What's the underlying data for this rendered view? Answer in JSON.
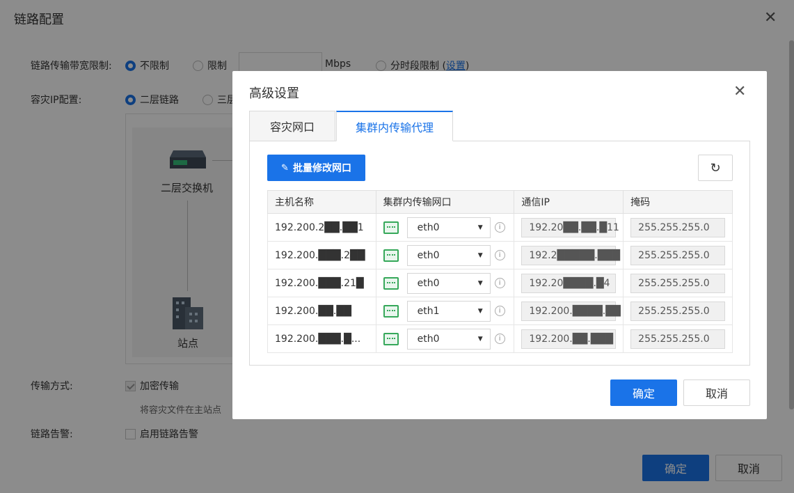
{
  "outer": {
    "title": "链路配置",
    "bandwidth": {
      "label": "链路传输带宽限制:",
      "options": [
        "不限制",
        "限制",
        "分时段限制 ("
      ],
      "selected": "不限制",
      "unit": "Mbps",
      "settings_link": "设置",
      "close_paren": ")"
    },
    "dr_ip": {
      "label": "容灾IP配置:",
      "options": [
        "二层链路",
        "三层"
      ],
      "selected": "二层链路"
    },
    "topology": {
      "switch_label": "二层交换机",
      "site_label": "站点"
    },
    "transfer": {
      "label": "传输方式:",
      "checkbox_label": "加密传输",
      "checked": true,
      "note": "将容灾文件在主站点"
    },
    "alarm": {
      "label": "链路告警:",
      "checkbox_label": "启用链路告警",
      "checked": false
    },
    "buttons": {
      "ok": "确定",
      "cancel": "取消"
    }
  },
  "modal": {
    "title": "高级设置",
    "tabs": [
      {
        "label": "容灾网口",
        "active": false
      },
      {
        "label": "集群内传输代理",
        "active": true
      }
    ],
    "batch_button": "批量修改网口",
    "table": {
      "columns": [
        "主机名称",
        "集群内传输网口",
        "通信IP",
        "掩码"
      ],
      "rows": [
        {
          "host": "192.200.2██.██1",
          "nic": "eth0",
          "ip": "192.20██.██.█11",
          "mask": "255.255.255.0"
        },
        {
          "host": "192.200.███.2██",
          "nic": "eth0",
          "ip": "192.2█████.███",
          "mask": "255.255.255.0"
        },
        {
          "host": "192.200.███.21█",
          "nic": "eth0",
          "ip": "192.20████.█4",
          "mask": "255.255.255.0"
        },
        {
          "host": "192.200.██.██",
          "nic": "eth1",
          "ip": "192.200.████.██",
          "mask": "255.255.255.0"
        },
        {
          "host": "192.200.███.█...",
          "nic": "eth0",
          "ip": "192.200.██.███",
          "mask": "255.255.255.0"
        }
      ]
    },
    "buttons": {
      "ok": "确定",
      "cancel": "取消"
    }
  }
}
